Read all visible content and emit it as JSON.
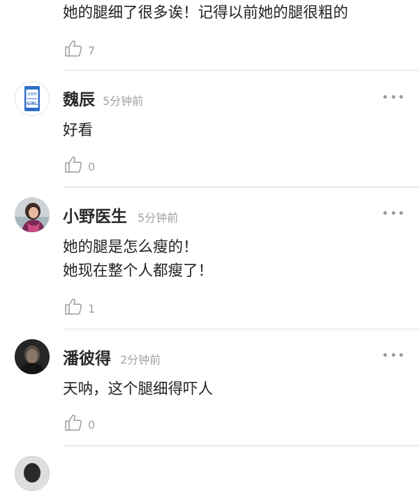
{
  "comments": [
    {
      "text_lines": [
        "她的腿细了很多诶！记得以前她的腿很粗的"
      ],
      "like_icon": "thumbs-up-outline-icon",
      "likes": "7"
    },
    {
      "author": "魏辰",
      "time": "5分钟前",
      "avatar_icon": "girl-phone-logo-avatar",
      "avatar_text_top": "多图特",
      "avatar_text_bottom": "GiRL",
      "text_lines": [
        "好看"
      ],
      "like_icon": "thumbs-up-outline-icon",
      "likes": "0"
    },
    {
      "author": "小野医生",
      "time": "5分钟前",
      "avatar_icon": "woman-photo-avatar",
      "text_lines": [
        "她的腿是怎么瘦的！",
        "她现在整个人都瘦了！"
      ],
      "like_icon": "thumbs-up-outline-icon",
      "likes": "1"
    },
    {
      "author": "潘彼得",
      "time": "2分钟前",
      "avatar_icon": "dark-portrait-avatar",
      "text_lines": [
        "天呐，这个腿细得吓人"
      ],
      "like_icon": "thumbs-up-outline-icon",
      "likes": "0"
    }
  ],
  "colors": {
    "name": "#2a2a2a",
    "meta": "#a3a3a3",
    "divider": "#dcdcdc",
    "avatar_blue": "#2f6fc6"
  }
}
